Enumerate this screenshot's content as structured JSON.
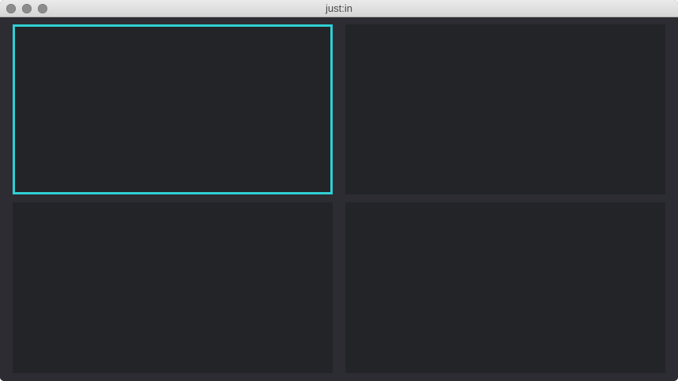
{
  "window": {
    "title": "just:in",
    "accent_color": "#2fd0d4",
    "background_color": "#2c2c32",
    "pane_color": "#232428"
  },
  "grid": {
    "rows": 2,
    "columns": 2,
    "selected_pane": 1
  }
}
